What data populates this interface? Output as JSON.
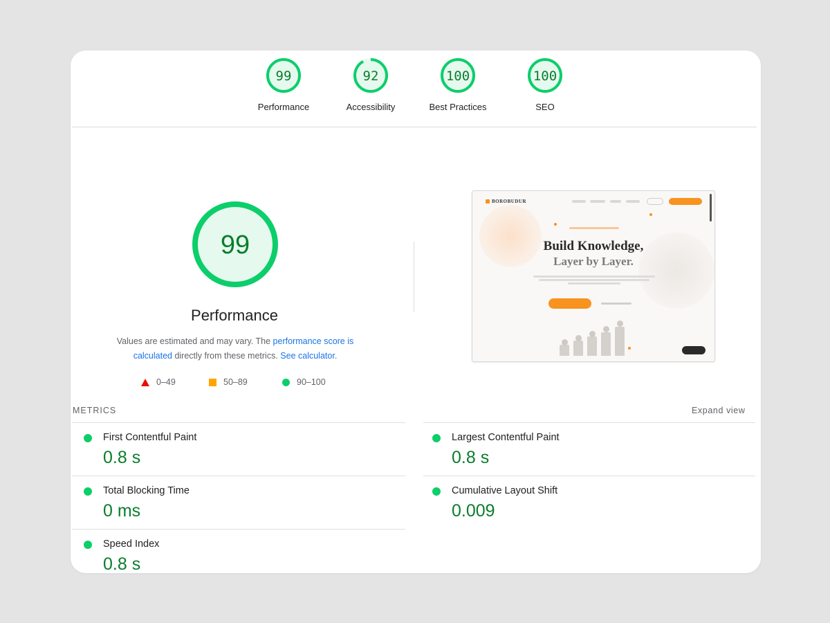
{
  "categories": [
    {
      "label": "Performance",
      "score": "99"
    },
    {
      "label": "Accessibility",
      "score": "92"
    },
    {
      "label": "Best Practices",
      "score": "100"
    },
    {
      "label": "SEO",
      "score": "100"
    }
  ],
  "main_score": {
    "score": "99",
    "title": "Performance"
  },
  "description": {
    "text1": "Values are estimated and may vary. The ",
    "link1": "performance score is calculated",
    "text2": " directly from these metrics. ",
    "link2": "See calculator",
    "text3": "."
  },
  "legend": [
    {
      "range": "0–49",
      "icon": "red-triangle",
      "color": "#eb0f00"
    },
    {
      "range": "50–89",
      "icon": "orange-square",
      "color": "#ffa400"
    },
    {
      "range": "90–100",
      "icon": "green-circle",
      "color": "#0cce6b"
    }
  ],
  "colors": {
    "pass": "#0cce6b",
    "pass_text": "#0a7d2c",
    "link": "#1a73e8",
    "accent": "#f7931e"
  },
  "metrics_label": "METRICS",
  "expand_view": "Expand view",
  "metrics": [
    {
      "name": "First Contentful Paint",
      "value": "0.8 s"
    },
    {
      "name": "Largest Contentful Paint",
      "value": "0.8 s"
    },
    {
      "name": "Total Blocking Time",
      "value": "0 ms"
    },
    {
      "name": "Cumulative Layout Shift",
      "value": "0.009"
    },
    {
      "name": "Speed Index",
      "value": "0.8 s"
    }
  ],
  "screenshot": {
    "logo": "BOROBUDUR",
    "headline1": "Build Knowledge,",
    "headline2": "Layer by Layer."
  }
}
